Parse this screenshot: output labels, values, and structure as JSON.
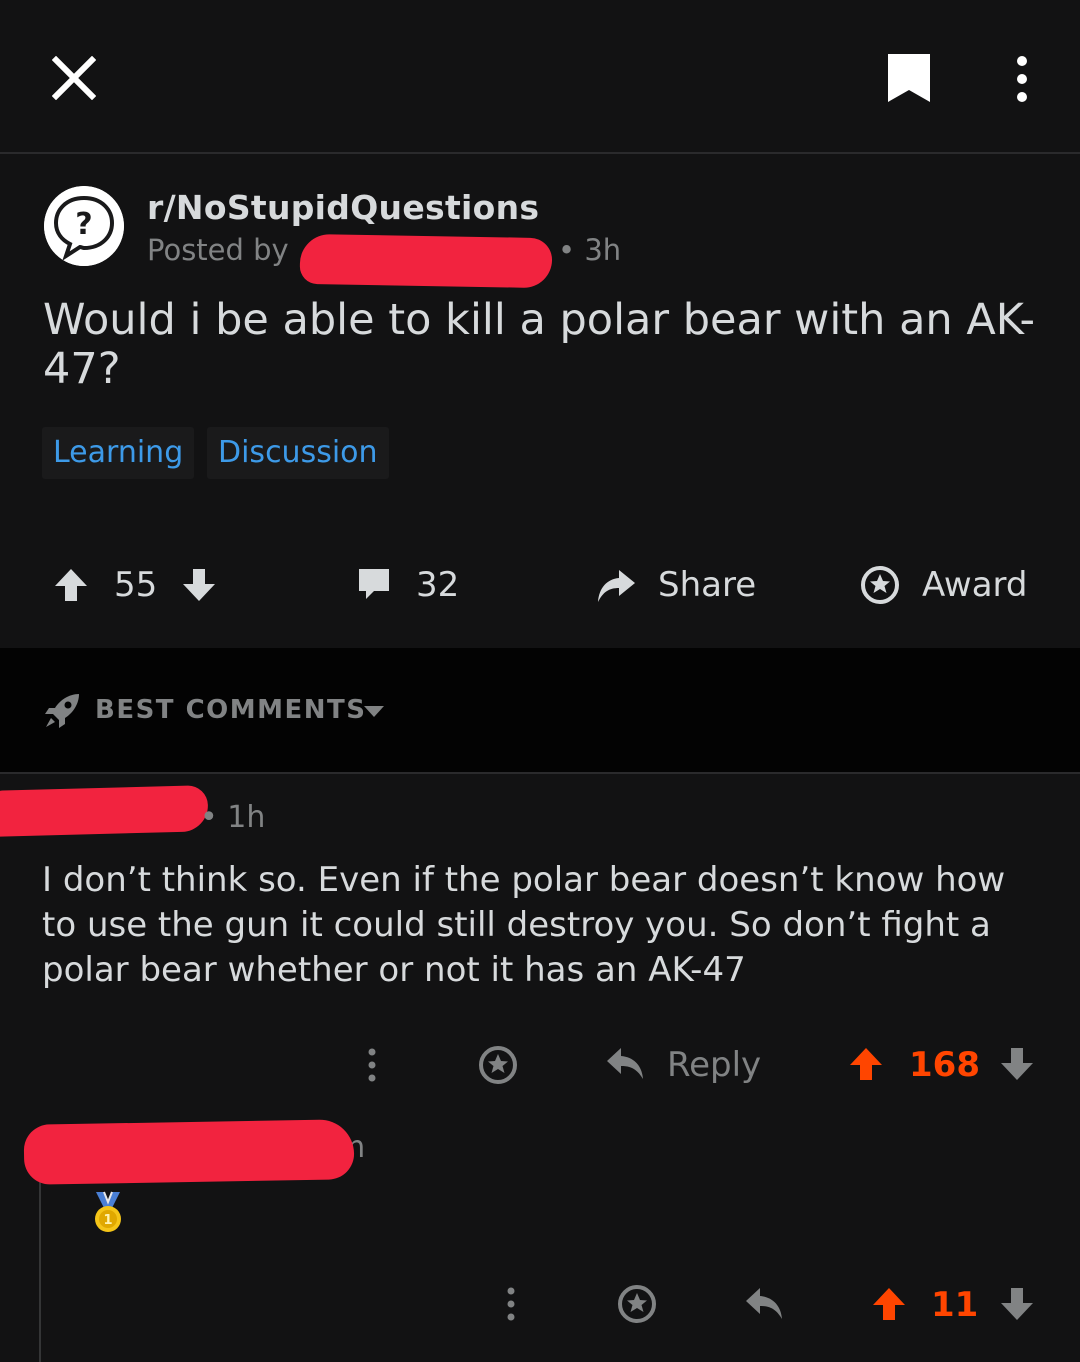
{
  "post": {
    "subreddit": "r/NoStupidQuestions",
    "posted_by_label": "Posted by",
    "age": "• 3h",
    "title": "Would i be able to kill a polar bear with an AK-47?",
    "flairs": [
      "Learning",
      "Discussion"
    ],
    "score": "55",
    "comments": "32",
    "share_label": "Share",
    "award_label": "Award"
  },
  "sort": {
    "label": "BEST COMMENTS"
  },
  "comments": [
    {
      "age": "• 1h",
      "body": "I don’t think so. Even if the polar bear doesn’t know how to use the gun it could still destroy you. So don’t fight a polar bear whether or not it has an AK-47",
      "reply_label": "Reply",
      "score": "168"
    },
    {
      "age": "m",
      "score": "11",
      "award_icon": "gold-medal-icon"
    }
  ],
  "colors": {
    "background": "#121213",
    "upvoted": "#ff4500",
    "flair_text": "#3d9ae8",
    "redaction": "#f2233f"
  }
}
